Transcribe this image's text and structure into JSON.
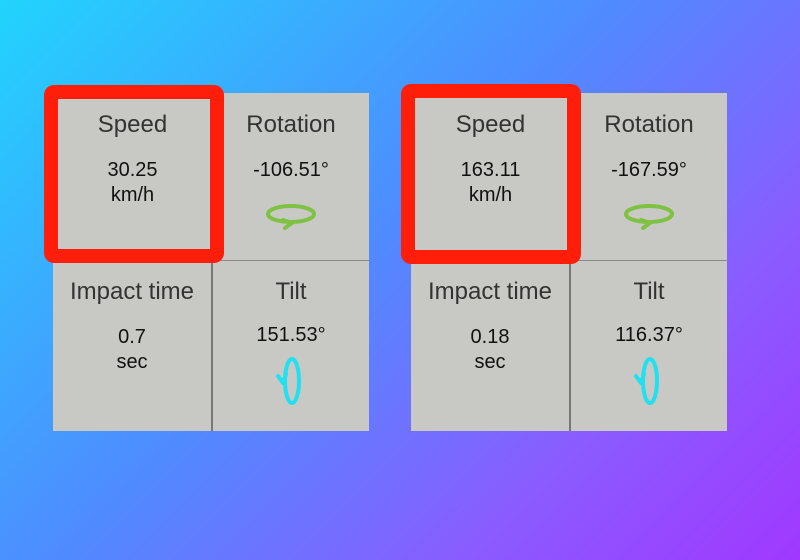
{
  "panels": [
    {
      "speed": {
        "title": "Speed",
        "value": "30.25",
        "unit": "km/h"
      },
      "rotation": {
        "title": "Rotation",
        "value": "-106.51°"
      },
      "impact": {
        "title": "Impact time",
        "value": "0.7",
        "unit": "sec"
      },
      "tilt": {
        "title": "Tilt",
        "value": "151.53°"
      }
    },
    {
      "speed": {
        "title": "Speed",
        "value": "163.11",
        "unit": "km/h"
      },
      "rotation": {
        "title": "Rotation",
        "value": "-167.59°"
      },
      "impact": {
        "title": "Impact time",
        "value": "0.18",
        "unit": "sec"
      },
      "tilt": {
        "title": "Tilt",
        "value": "116.37°"
      }
    }
  ],
  "icons": {
    "rotation": "rotation-arrow-icon",
    "tilt": "tilt-arrow-icon"
  },
  "colors": {
    "highlight": "#ff1e0a",
    "cell_bg": "#c8c9c4",
    "rotation_icon": "#7fc243",
    "tilt_icon": "#22e0f0"
  }
}
